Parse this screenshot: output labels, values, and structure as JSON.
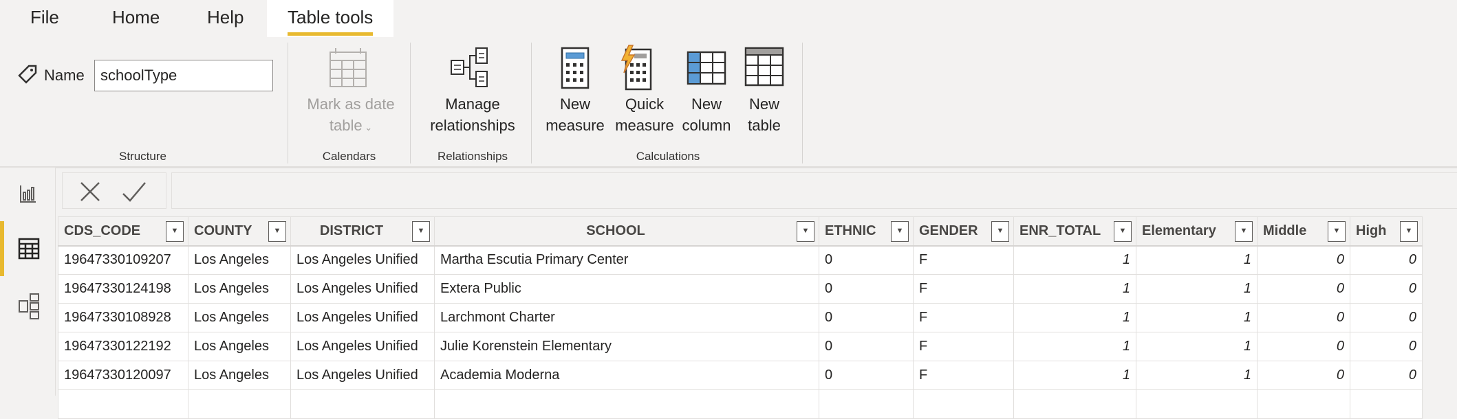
{
  "tabs": [
    {
      "label": "File"
    },
    {
      "label": "Home"
    },
    {
      "label": "Help"
    },
    {
      "label": "Table tools",
      "active": true
    }
  ],
  "accent": "#e8b92f",
  "structure": {
    "name_label": "Name",
    "name_value": "schoolType",
    "group": "Structure"
  },
  "calendars": {
    "button_line1": "Mark as date",
    "button_line2": "table",
    "group": "Calendars"
  },
  "relationships": {
    "button_line1": "Manage",
    "button_line2": "relationships",
    "group": "Relationships"
  },
  "calculations": {
    "group": "Calculations",
    "buttons": [
      {
        "line1": "New",
        "line2": "measure"
      },
      {
        "line1": "Quick",
        "line2": "measure"
      },
      {
        "line1": "New",
        "line2": "column"
      },
      {
        "line1": "New",
        "line2": "table"
      }
    ]
  },
  "sidebar": [
    "report-view",
    "data-view",
    "model-view"
  ],
  "table": {
    "columns": [
      "CDS_CODE",
      "COUNTY",
      "DISTRICT",
      "SCHOOL",
      "ETHNIC",
      "GENDER",
      "ENR_TOTAL",
      "Elementary",
      "Middle",
      "High"
    ],
    "rows": [
      [
        "19647330109207",
        "Los Angeles",
        "Los Angeles Unified",
        "Martha Escutia Primary Center",
        "0",
        "F",
        "1",
        "1",
        "0",
        "0"
      ],
      [
        "19647330124198",
        "Los Angeles",
        "Los Angeles Unified",
        "Extera Public",
        "0",
        "F",
        "1",
        "1",
        "0",
        "0"
      ],
      [
        "19647330108928",
        "Los Angeles",
        "Los Angeles Unified",
        "Larchmont Charter",
        "0",
        "F",
        "1",
        "1",
        "0",
        "0"
      ],
      [
        "19647330122192",
        "Los Angeles",
        "Los Angeles Unified",
        "Julie Korenstein Elementary",
        "0",
        "F",
        "1",
        "1",
        "0",
        "0"
      ],
      [
        "19647330120097",
        "Los Angeles",
        "Los Angeles Unified",
        "Academia Moderna",
        "0",
        "F",
        "1",
        "1",
        "0",
        "0"
      ]
    ]
  }
}
